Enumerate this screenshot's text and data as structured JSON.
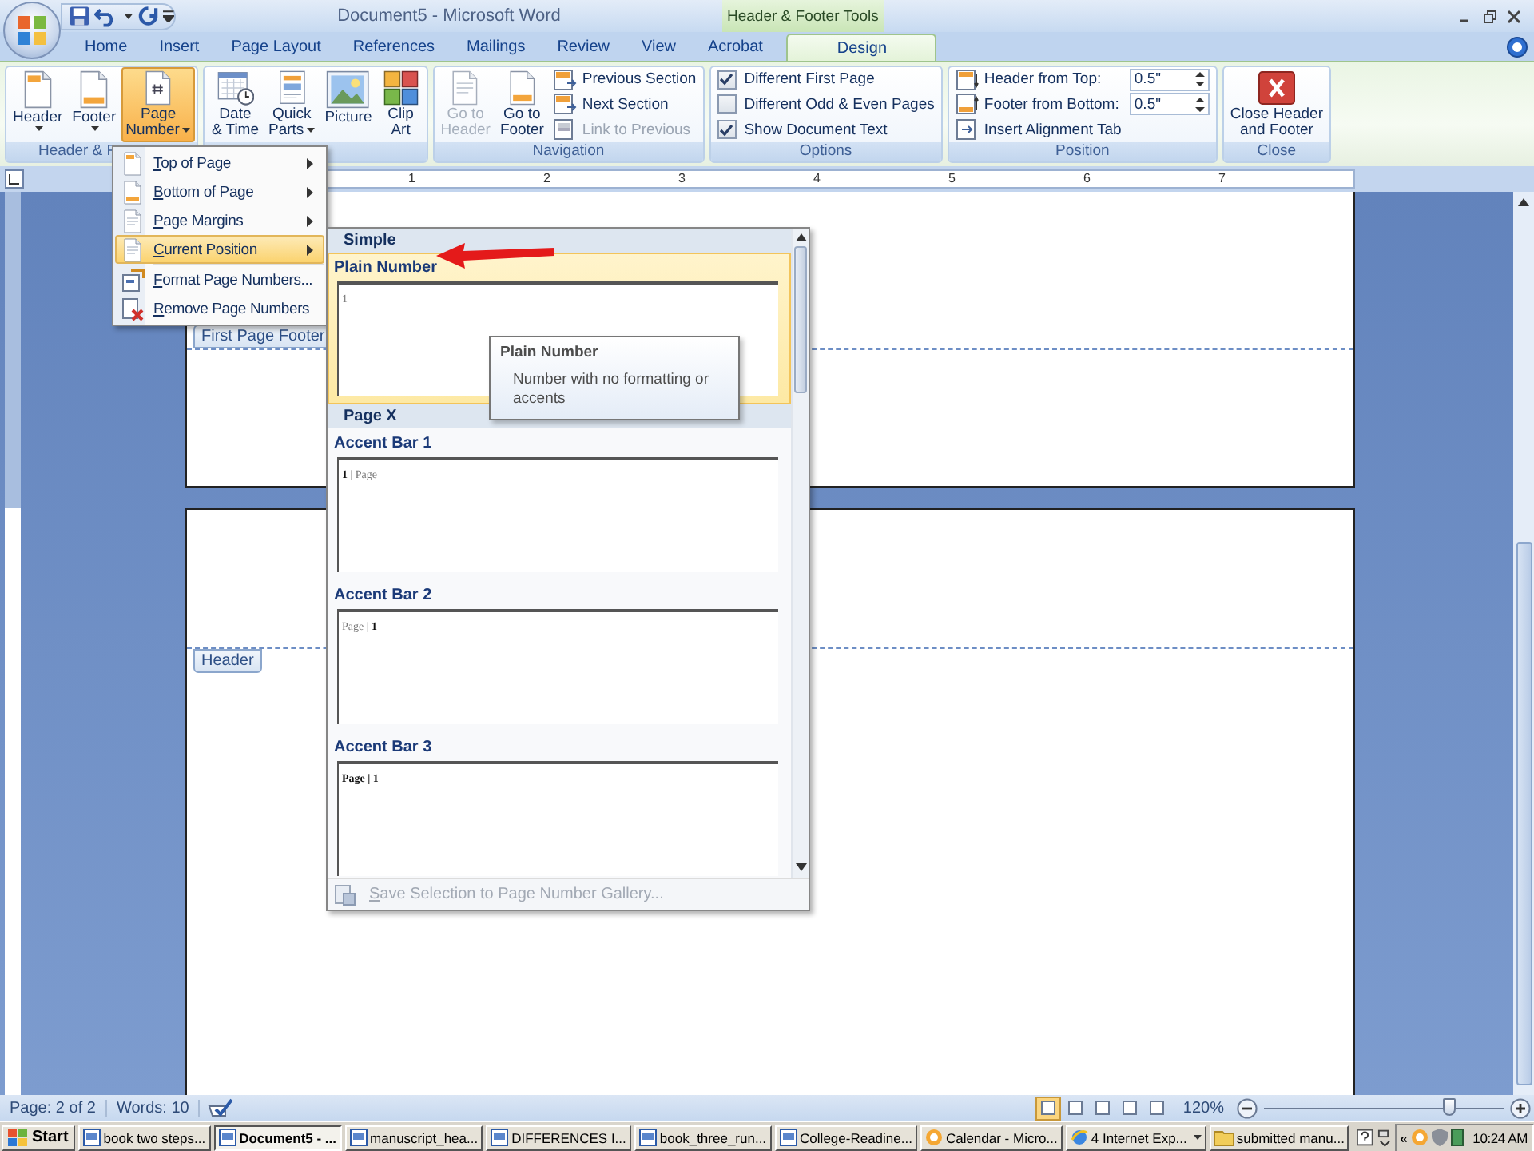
{
  "title_bar": {
    "title": "Document5 - Microsoft Word",
    "context_tab": "Header & Footer Tools"
  },
  "tabs": [
    {
      "label": "Home",
      "selected": false
    },
    {
      "label": "Insert",
      "selected": false
    },
    {
      "label": "Page Layout",
      "selected": false
    },
    {
      "label": "References",
      "selected": false
    },
    {
      "label": "Mailings",
      "selected": false
    },
    {
      "label": "Review",
      "selected": false
    },
    {
      "label": "View",
      "selected": false
    },
    {
      "label": "Acrobat",
      "selected": false
    },
    {
      "label": "Design",
      "selected": true
    }
  ],
  "ribbon": {
    "groups": [
      {
        "label": "Header & F",
        "controls": [
          {
            "kind": "large",
            "label": "Header",
            "dropdown": true,
            "selected": false,
            "disabled": false
          },
          {
            "kind": "large",
            "label": "Footer",
            "dropdown": true,
            "selected": false,
            "disabled": false
          },
          {
            "kind": "large",
            "label": "Page\nNumber",
            "dropdown": true,
            "selected": true,
            "disabled": false
          }
        ]
      },
      {
        "controls": [
          {
            "kind": "large",
            "label": "Date\n& Time",
            "dropdown": false,
            "selected": false,
            "disabled": false
          },
          {
            "kind": "large",
            "label": "Quick\nParts",
            "dropdown": true,
            "selected": false,
            "disabled": false
          },
          {
            "kind": "large",
            "label": "Picture",
            "dropdown": false,
            "selected": false,
            "disabled": false
          },
          {
            "kind": "large",
            "label": "Clip\nArt",
            "dropdown": false,
            "selected": false,
            "disabled": false
          }
        ]
      },
      {
        "label": "Navigation",
        "controls": [
          {
            "kind": "large",
            "label": "Go to\nHeader",
            "dropdown": false,
            "selected": false,
            "disabled": true
          },
          {
            "kind": "large",
            "label": "Go to\nFooter",
            "dropdown": false,
            "selected": false,
            "disabled": false
          },
          {
            "kind": "stack",
            "items": [
              {
                "kind": "small",
                "label": "Previous Section",
                "disabled": false
              },
              {
                "kind": "small",
                "label": "Next Section",
                "disabled": false
              },
              {
                "kind": "small",
                "label": "Link to Previous",
                "disabled": true
              }
            ]
          }
        ]
      },
      {
        "label": "Options",
        "controls": [
          {
            "kind": "stack",
            "items": [
              {
                "kind": "check",
                "label": "Different First Page",
                "checked": true
              },
              {
                "kind": "check",
                "label": "Different Odd & Even Pages",
                "checked": false
              },
              {
                "kind": "check",
                "label": "Show Document Text",
                "checked": true
              }
            ]
          }
        ]
      },
      {
        "label": "Position",
        "controls": [
          {
            "kind": "stack",
            "items": [
              {
                "kind": "spin",
                "label": "Header from Top:",
                "value": "0.5\""
              },
              {
                "kind": "spin",
                "label": "Footer from Bottom:",
                "value": "0.5\""
              },
              {
                "kind": "small",
                "label": "Insert Alignment Tab",
                "disabled": false
              }
            ]
          }
        ]
      },
      {
        "label": "Close",
        "controls": [
          {
            "kind": "large",
            "label": "Close Header\nand Footer",
            "dropdown": false,
            "selected": false,
            "disabled": false
          }
        ]
      }
    ]
  },
  "ruler_numbers": [
    "1",
    "2",
    "3",
    "4",
    "5",
    "6",
    "7"
  ],
  "pages": [
    {
      "tag": "First Page Footer"
    },
    {
      "tag": "Header"
    }
  ],
  "menu": {
    "items": [
      {
        "label": "Top of Page",
        "submenu": true,
        "selected": false
      },
      {
        "label": "Bottom of Page",
        "submenu": true,
        "selected": false
      },
      {
        "label": "Page Margins",
        "submenu": true,
        "selected": false
      },
      {
        "label": "Current Position",
        "submenu": true,
        "selected": true
      },
      {
        "label": "Format Page Numbers...",
        "submenu": false,
        "selected": false
      },
      {
        "label": "Remove Page Numbers",
        "submenu": false,
        "selected": false
      }
    ]
  },
  "gallery": {
    "sections": [
      {
        "heading": "Simple",
        "items": [
          {
            "name": "Plain Number",
            "preview": "1",
            "selected": true
          }
        ]
      },
      {
        "heading": "Page X",
        "items": [
          {
            "name": "Accent Bar 1",
            "preview": "**1** | Page",
            "selected": false
          },
          {
            "name": "Accent Bar 2",
            "preview": "Page | **1**",
            "selected": false
          },
          {
            "name": "Accent Bar 3",
            "preview": "**Page | 1**",
            "selected": false
          }
        ]
      }
    ],
    "footer": {
      "label": "Save Selection to Page Number Gallery...",
      "disabled": true
    }
  },
  "tooltip": {
    "title": "Plain Number",
    "text": "Number with no formatting or accents"
  },
  "status_bar": {
    "page": "Page: 2 of 2",
    "words": "Words: 10",
    "views": [
      {
        "selected": true
      },
      {
        "selected": false
      },
      {
        "selected": false
      },
      {
        "selected": false
      },
      {
        "selected": false
      }
    ],
    "zoom": "120%",
    "zoom_slider": {
      "level": 0.77
    }
  },
  "taskbar": {
    "start": "Start",
    "tasks": [
      {
        "label": "book two steps...",
        "kind": "document",
        "selected": false,
        "dropdown": false
      },
      {
        "label": "Document5 - ...",
        "kind": "document",
        "selected": true,
        "dropdown": false
      },
      {
        "label": "manuscript_hea...",
        "kind": "document",
        "selected": false,
        "dropdown": false
      },
      {
        "label": "DIFFERENCES I...",
        "kind": "document",
        "selected": false,
        "dropdown": false
      },
      {
        "label": "book_three_run...",
        "kind": "document",
        "selected": false,
        "dropdown": false
      },
      {
        "label": "College-Readine...",
        "kind": "document",
        "selected": false,
        "dropdown": false
      },
      {
        "label": "Calendar - Micro...",
        "kind": "calendar",
        "selected": false,
        "dropdown": false
      },
      {
        "label": "4 Internet Exp...",
        "kind": "browser",
        "selected": false,
        "dropdown": true
      },
      {
        "label": "submitted manu...",
        "kind": "folder",
        "selected": false,
        "dropdown": false
      }
    ],
    "chevron": "«",
    "clock": "10:24 AM"
  }
}
